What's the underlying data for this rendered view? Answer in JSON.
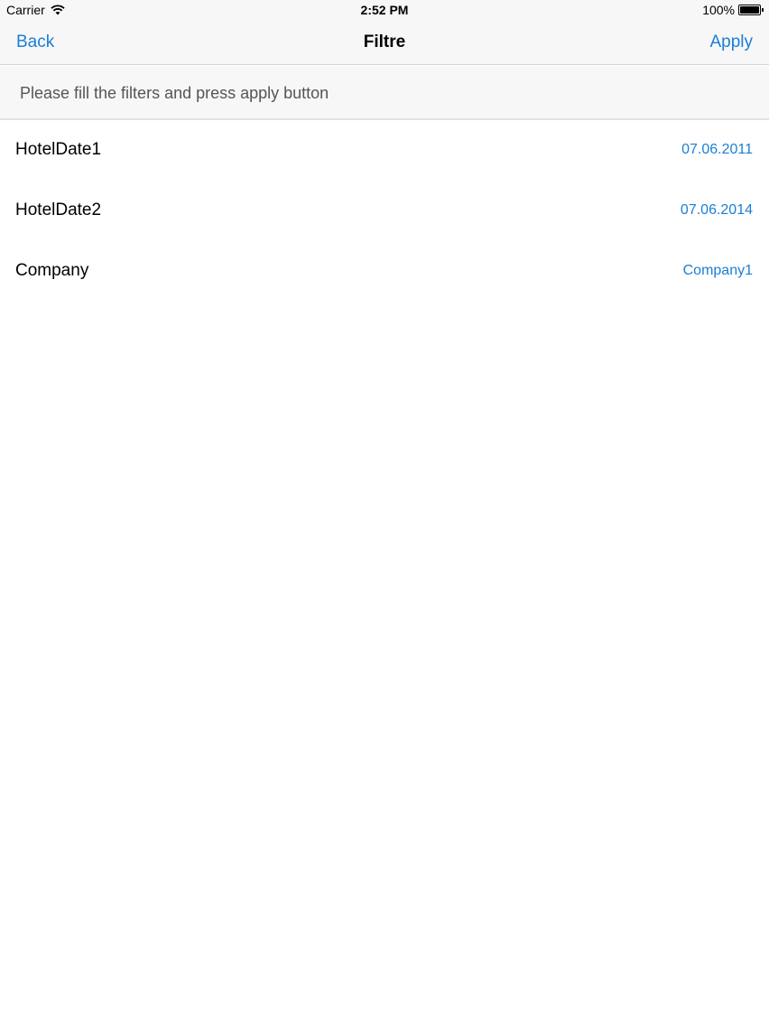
{
  "status_bar": {
    "carrier": "Carrier",
    "time": "2:52 PM",
    "battery": "100%",
    "wifi_icon": "wifi-icon",
    "battery_icon": "battery-icon"
  },
  "nav": {
    "back_label": "Back",
    "title": "Filtre",
    "apply_label": "Apply"
  },
  "hint": "Please fill the filters and press apply button",
  "filters": [
    {
      "label": "HotelDate1",
      "value": "07.06.2011"
    },
    {
      "label": "HotelDate2",
      "value": "07.06.2014"
    },
    {
      "label": "Company",
      "value": "Company1"
    }
  ],
  "colors": {
    "accent": "#1a7fd4",
    "bar_background": "#f7f7f8"
  }
}
